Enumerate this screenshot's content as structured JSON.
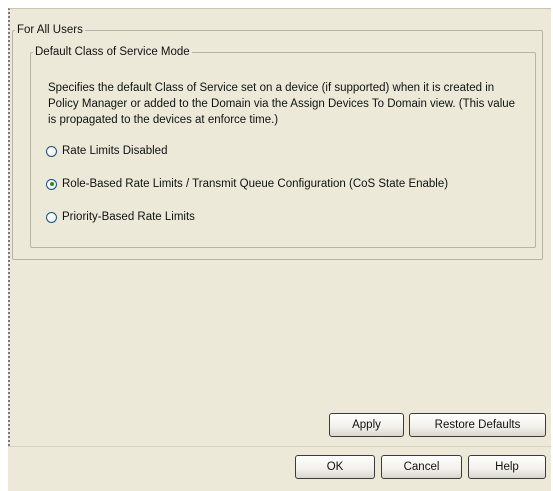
{
  "group_outer": {
    "legend": "For All Users"
  },
  "group_inner": {
    "legend": "Default Class of Service Mode"
  },
  "description": "Specifies the default Class of Service set on a device (if supported) when it is created in Policy Manager or added to the Domain via the Assign Devices To Domain view. (This value is propagated to the devices at enforce time.)",
  "options": [
    {
      "label": "Rate Limits Disabled",
      "selected": false
    },
    {
      "label": "Role-Based Rate Limits / Transmit Queue Configuration (CoS State Enable)",
      "selected": true
    },
    {
      "label": "Priority-Based Rate Limits",
      "selected": false
    }
  ],
  "buttons": {
    "apply": "Apply",
    "restore_defaults": "Restore Defaults",
    "ok": "OK",
    "cancel": "Cancel",
    "help": "Help"
  },
  "colors": {
    "dialog_bg": "#ece9d8",
    "radio_border": "#1c5180",
    "radio_selected": "#2b8b2b"
  }
}
